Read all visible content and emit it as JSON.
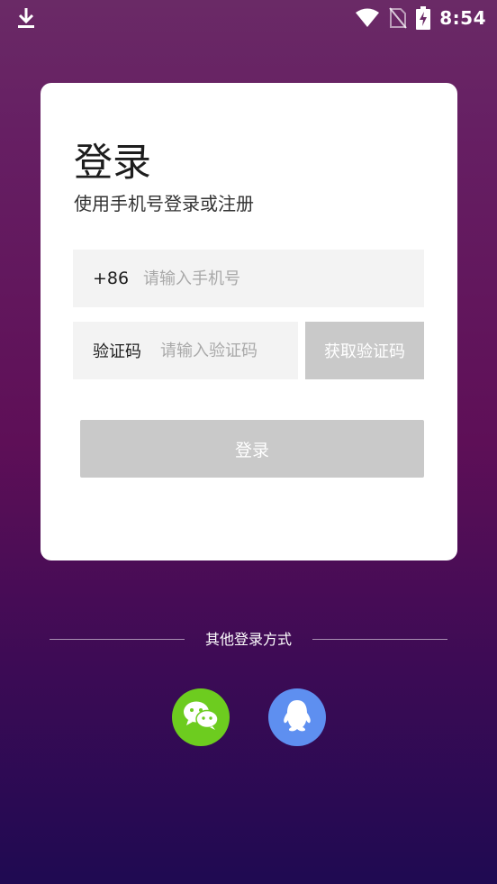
{
  "status_bar": {
    "time": "8:54",
    "icons": [
      "download-icon",
      "wifi-icon",
      "no-sim-icon",
      "battery-charging-icon"
    ]
  },
  "login_card": {
    "title": "登录",
    "subtitle": "使用手机号登录或注册",
    "phone": {
      "prefix": "+86",
      "placeholder": "请输入手机号",
      "value": ""
    },
    "code": {
      "label": "验证码",
      "placeholder": "请输入验证码",
      "value": ""
    },
    "get_code_label": "获取验证码",
    "login_label": "登录"
  },
  "other_login": {
    "label": "其他登录方式",
    "providers": [
      {
        "icon": "wechat-icon",
        "color": "#6dcc1f"
      },
      {
        "icon": "qq-icon",
        "color": "#5e8ff0"
      }
    ]
  },
  "colors": {
    "background_top": "#6a2a66",
    "background_bottom": "#1f0a52",
    "disabled_button": "#c9c9c9",
    "input_bg": "#f3f3f3"
  }
}
